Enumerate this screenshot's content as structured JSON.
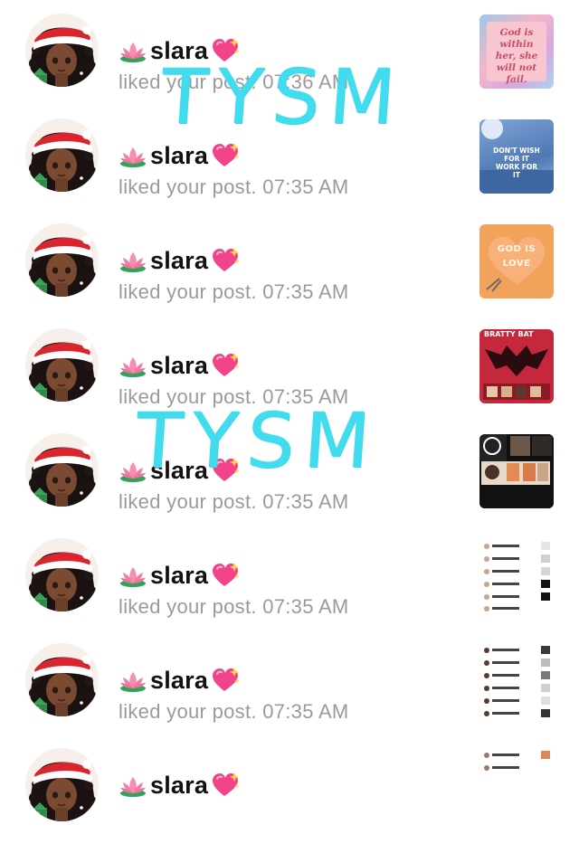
{
  "rows": [
    {
      "username": "slara",
      "activity": "liked your post.",
      "time": "07:36 AM"
    },
    {
      "username": "slara",
      "activity": "liked your post.",
      "time": "07:35 AM"
    },
    {
      "username": "slara",
      "activity": "liked your post.",
      "time": "07:35 AM"
    },
    {
      "username": "slara",
      "activity": "liked your post.",
      "time": "07:35 AM"
    },
    {
      "username": "slara",
      "activity": "liked your post.",
      "time": "07:35 AM"
    },
    {
      "username": "slara",
      "activity": "liked your post.",
      "time": "07:35 AM"
    },
    {
      "username": "slara",
      "activity": "liked your post.",
      "time": "07:35 AM"
    },
    {
      "username": "slara",
      "activity": "liked your post.",
      "time": ""
    }
  ],
  "icons": {
    "prefix": "lotus-emoji-icon",
    "suffix": "sparkling-heart-emoji-icon"
  },
  "thumbnails": {
    "t1": {
      "text": "God is within her, she will not fail."
    },
    "t2": {
      "text": "DON'T WISH FOR IT WORK FOR IT"
    },
    "t3": {
      "text": "GOD IS LOVE"
    },
    "t4": {
      "text": "BRATTY BAT"
    }
  },
  "overlays": [
    "TYSM",
    "TYSM"
  ],
  "colors": {
    "overlay": "#41ddef",
    "activity_text": "#9a9a9a",
    "username_text": "#111111",
    "heart_pink": "#f0438a",
    "lotus_pink": "#f27fa6"
  }
}
